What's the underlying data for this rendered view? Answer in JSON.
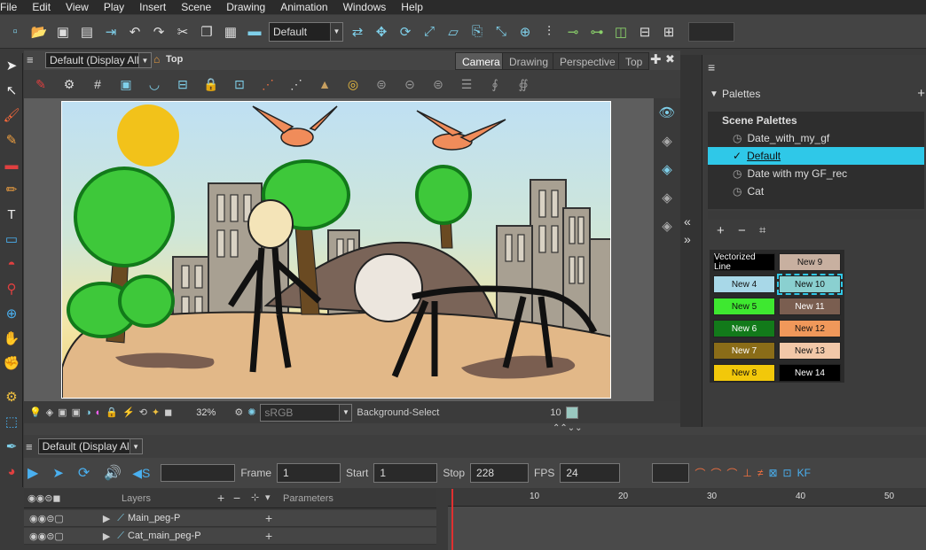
{
  "menu": [
    "File",
    "Edit",
    "View",
    "Play",
    "Insert",
    "Scene",
    "Drawing",
    "Animation",
    "Windows",
    "Help"
  ],
  "toolbar": {
    "workspace": "Default"
  },
  "view": {
    "display": "Default (Display All)",
    "breadcrumb": "Top",
    "tabs": [
      "Camera",
      "Drawing",
      "Perspective",
      "Top"
    ],
    "active_tab": "Camera"
  },
  "status": {
    "zoom": "32%",
    "color_space": "sRGB",
    "mode": "Background-Select",
    "frame": "10"
  },
  "palettes": {
    "header": "Palettes",
    "section": "Scene Palettes",
    "items": [
      "Date_with_my_gf",
      "Default",
      "Date with my GF_rec",
      "Cat"
    ],
    "selected": "Default"
  },
  "swatches": [
    {
      "label": "Vectorized Line",
      "color": "#000000",
      "text": "#ffffff"
    },
    {
      "label": "New 9",
      "color": "#c8b0a0",
      "text": "#111111"
    },
    {
      "label": "New 4",
      "color": "#a8d8e8",
      "text": "#111111"
    },
    {
      "label": "New 10",
      "color": "#8ad0d0",
      "text": "#111111"
    },
    {
      "label": "New 5",
      "color": "#3ee830",
      "text": "#111111"
    },
    {
      "label": "New 11",
      "color": "#7a5e50",
      "text": "#ffffff"
    },
    {
      "label": "New 6",
      "color": "#127a1a",
      "text": "#ffffff"
    },
    {
      "label": "New 12",
      "color": "#f0985a",
      "text": "#111111"
    },
    {
      "label": "New 7",
      "color": "#8a6c18",
      "text": "#ffffff"
    },
    {
      "label": "New 13",
      "color": "#f2c8a8",
      "text": "#111111"
    },
    {
      "label": "New 8",
      "color": "#f2c80a",
      "text": "#111111"
    },
    {
      "label": "New 14",
      "color": "#000000",
      "text": "#ffffff"
    }
  ],
  "timeline": {
    "display": "Default (Display All)",
    "frame_label": "Frame",
    "frame": "1",
    "start_label": "Start",
    "start": "1",
    "stop_label": "Stop",
    "stop": "228",
    "fps_label": "FPS",
    "fps": "24",
    "layers_label": "Layers",
    "params_label": "Parameters",
    "ruler": [
      "10",
      "20",
      "30",
      "40",
      "50"
    ]
  },
  "layers": [
    "Main_peg-P",
    "Cat_main_peg-P"
  ]
}
